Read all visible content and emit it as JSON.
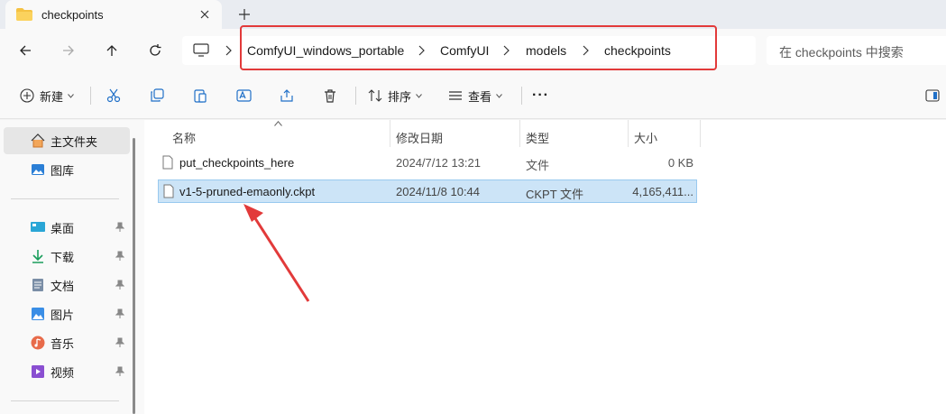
{
  "tab": {
    "title": "checkpoints"
  },
  "breadcrumb": [
    "ComfyUI_windows_portable",
    "ComfyUI",
    "models",
    "checkpoints"
  ],
  "search": {
    "placeholder": "在 checkpoints 中搜索"
  },
  "toolbar": {
    "new_label": "新建",
    "sort_label": "排序",
    "view_label": "查看",
    "more_label": "···"
  },
  "sidebar": {
    "home": "主文件夹",
    "gallery": "图库",
    "desktop": "桌面",
    "downloads": "下载",
    "documents": "文档",
    "pictures": "图片",
    "music": "音乐",
    "videos": "视频"
  },
  "columns": {
    "name": "名称",
    "modified": "修改日期",
    "type": "类型",
    "size": "大小"
  },
  "files": [
    {
      "name": "put_checkpoints_here",
      "modified": "2024/7/12 13:21",
      "type": "文件",
      "size": "0 KB"
    },
    {
      "name": "v1-5-pruned-emaonly.ckpt",
      "modified": "2024/11/8 10:44",
      "type": "CKPT 文件",
      "size": "4,165,411..."
    }
  ],
  "colors": {
    "accent": "#0078d4",
    "selection": "#cce4f7",
    "annotation": "#e23a3a"
  }
}
